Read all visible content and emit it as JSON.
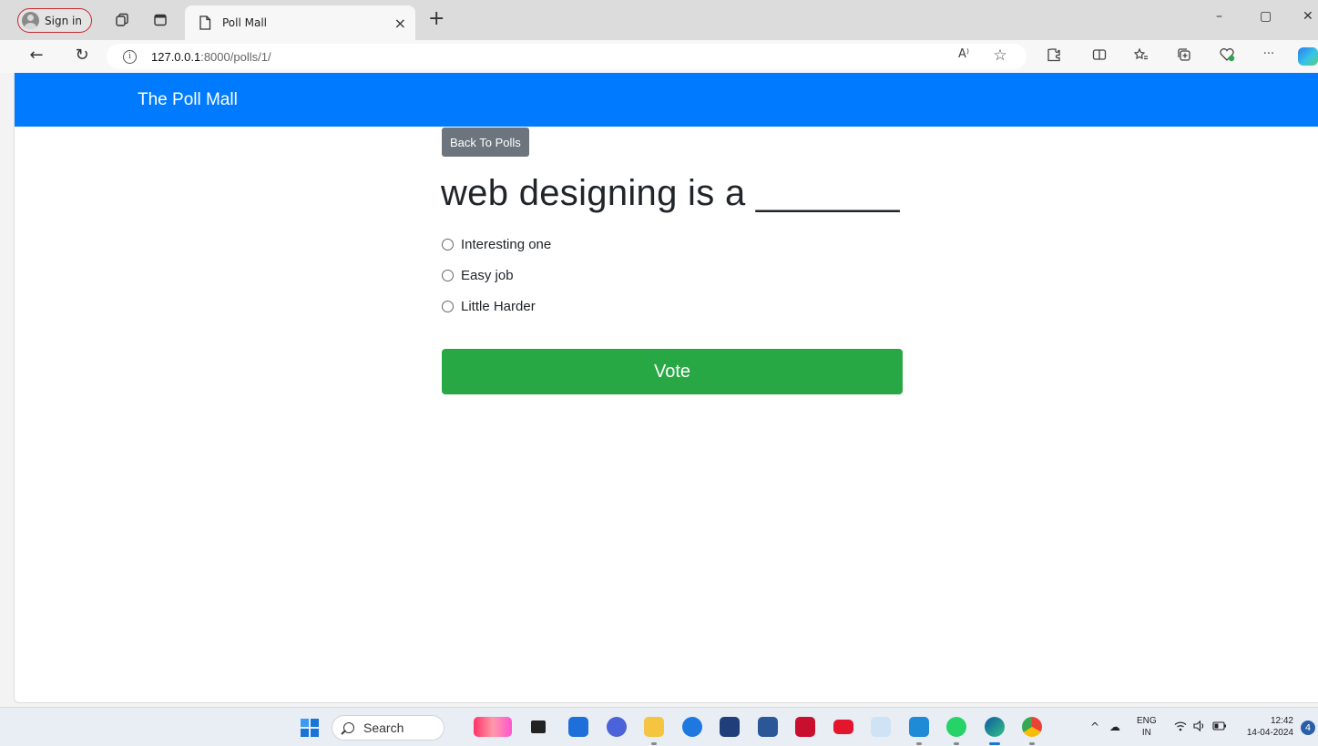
{
  "browser": {
    "profile_label": "Sign in",
    "tab": {
      "title": "Poll Mall",
      "close": "×"
    },
    "new_tab": "+",
    "window_controls": {
      "minimize": "–",
      "maximize": "▢",
      "close": "✕"
    },
    "url": {
      "host": "127.0.0.1",
      "path": ":8000/polls/1/"
    },
    "toolbar_icons": [
      "read-aloud-icon",
      "favorite-star-icon",
      "extensions-icon",
      "split-screen-icon",
      "favorites-icon",
      "collections-icon",
      "browser-essentials-icon",
      "more-icon",
      "copilot-icon"
    ],
    "read_aloud_glyph": "A⁾",
    "star_glyph": "☆",
    "more_glyph": "···"
  },
  "page": {
    "brand": "The Poll Mall",
    "back_button": "Back To Polls",
    "question": "web designing is a _______",
    "choices": [
      "Interesting one",
      "Easy job",
      "Little Harder"
    ],
    "vote_button": "Vote",
    "colors": {
      "navbar": "#007bff",
      "back_button": "#6c757d",
      "vote_button": "#28a745"
    }
  },
  "taskbar": {
    "search_label": "Search",
    "language": {
      "line1": "ENG",
      "line2": "IN"
    },
    "clock": {
      "time": "12:42",
      "date": "14-04-2024"
    },
    "notification_count": "4",
    "tray_chevron": "^"
  }
}
